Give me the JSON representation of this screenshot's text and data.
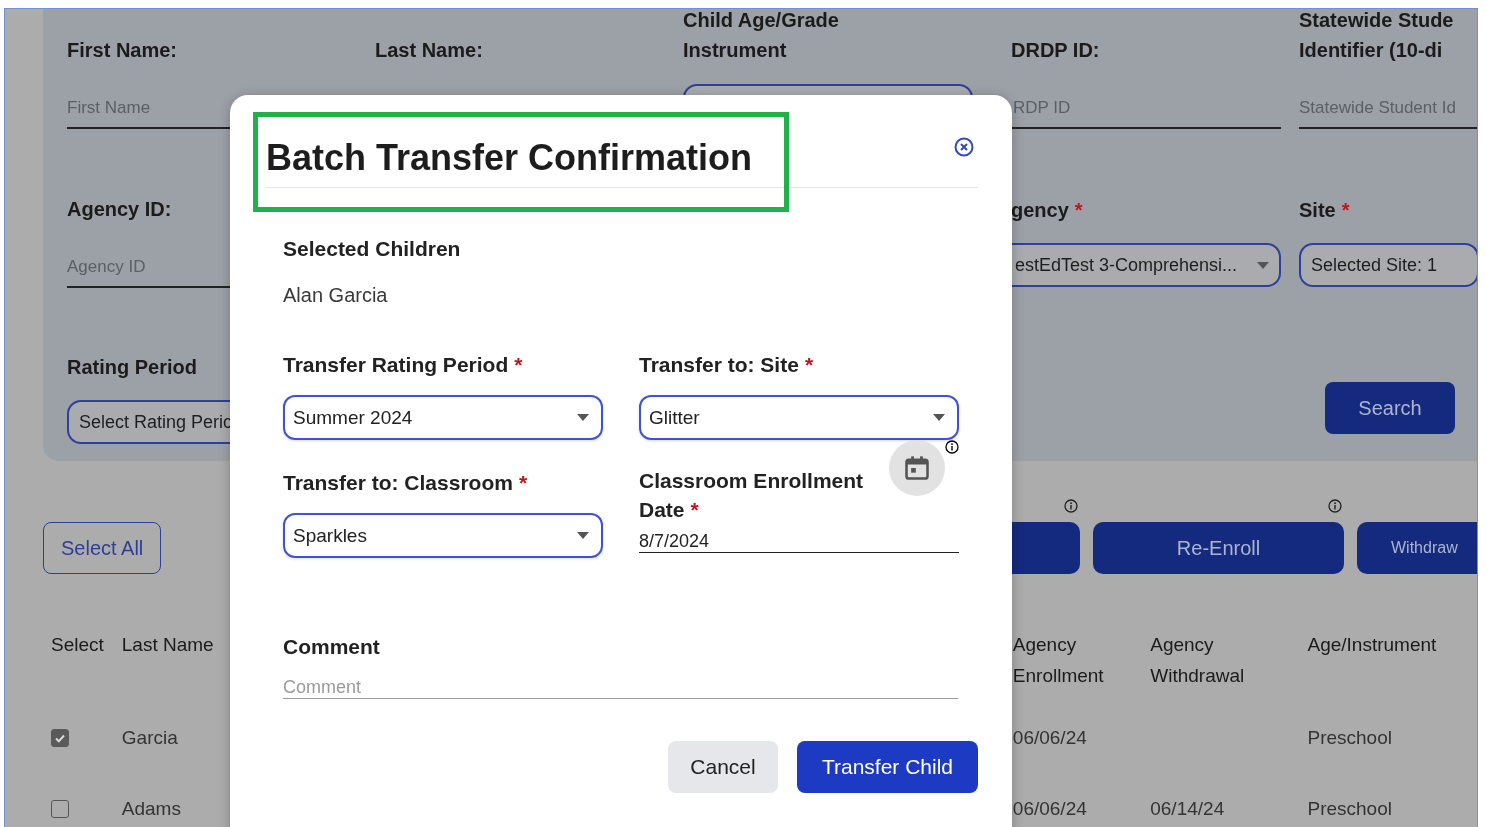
{
  "search_panel": {
    "rows": [
      [
        {
          "label_lines": [
            "First Name:"
          ],
          "kind": "text",
          "placeholder": "First Name"
        },
        {
          "label_lines": [
            "Last Name:"
          ],
          "kind": "none"
        },
        {
          "label_lines": [
            "Child Age/Grade",
            "Instrument"
          ],
          "kind": "select"
        },
        {
          "label_lines": [
            "DRDP ID:"
          ],
          "kind": "text",
          "placeholder": "RDP ID"
        },
        {
          "label_lines": [
            "Statewide Stude",
            "Identifier (10-di"
          ],
          "kind": "text",
          "placeholder": "Statewide Student Id"
        }
      ],
      [
        {
          "label_lines": [
            "Agency ID:"
          ],
          "kind": "text",
          "placeholder": "Agency ID"
        },
        {
          "kind": "none"
        },
        {
          "kind": "none"
        },
        {
          "label_lines": [
            "gency"
          ],
          "required_mark": "*",
          "kind": "select",
          "value": "estEdTest 3-Comprehensi..."
        },
        {
          "label_lines": [
            "Site"
          ],
          "required_mark": "*",
          "kind": "select",
          "value": "Selected Site: 1"
        }
      ],
      [
        {
          "label_lines": [
            "Rating Period"
          ],
          "kind": "select",
          "value": "Select Rating Peric"
        },
        {
          "kind": "none"
        },
        {
          "kind": "none"
        },
        {
          "kind": "none"
        },
        {
          "kind": "button",
          "value": "Search"
        }
      ]
    ]
  },
  "select_all": "Select All",
  "action_buttons": [
    {
      "info": true
    },
    {
      "label": "Re-Enroll",
      "info": true
    },
    {
      "label": "Withdraw",
      "info": false
    }
  ],
  "table": {
    "columns": [
      "Select",
      "Last Name",
      "Agency Enrollment",
      "Agency Withdrawal",
      "Age/Instrument"
    ],
    "rows": [
      {
        "selected": true,
        "last_name": "Garcia",
        "agency_enrollment": "06/06/24",
        "age_instrument": "Preschool"
      },
      {
        "selected": false,
        "last_name": "Adams",
        "agency_enrollment": "06/06/24",
        "agency_withdrawal": "06/14/24",
        "age_instrument": "Preschool"
      }
    ]
  },
  "dialog": {
    "title": "Batch Transfer Confirmation",
    "highlighted": true,
    "selected_children_label": "Selected Children",
    "selected_children": [
      "Alan Garcia"
    ],
    "fields": [
      {
        "label": "Transfer Rating Period",
        "required_mark": "*",
        "kind": "select",
        "value": "Summer 2024"
      },
      {
        "label": "Transfer to: Site",
        "required_mark": "*",
        "kind": "select",
        "value": "Glitter"
      },
      {
        "label": "Transfer to: Classroom",
        "required_mark": "*",
        "kind": "select",
        "value": "Sparkles"
      },
      {
        "label": "Classroom Enrollment Date",
        "required_mark": "*",
        "kind": "date",
        "value": "8/7/2024"
      }
    ],
    "comment": {
      "label": "Comment",
      "placeholder": "Comment"
    },
    "buttons": [
      {
        "label": "Cancel",
        "kind": "secondary"
      },
      {
        "label": "Transfer Child",
        "kind": "primary"
      }
    ]
  }
}
